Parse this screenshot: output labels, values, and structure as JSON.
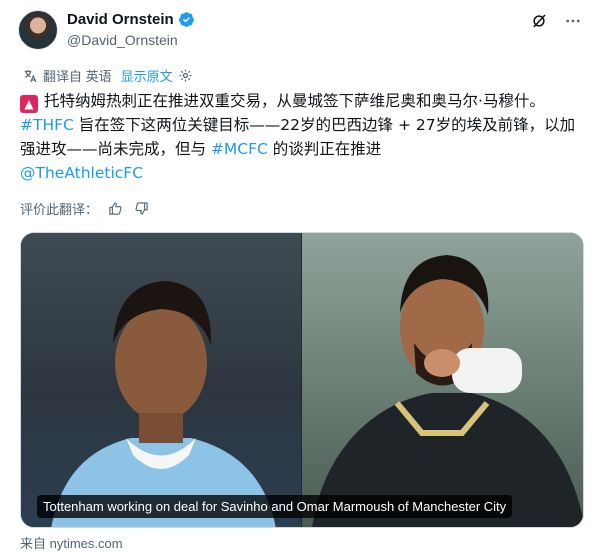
{
  "author": {
    "name": "David Ornstein",
    "handle": "@David_Ornstein",
    "verified_color": "#1d9bf0"
  },
  "translation_bar": {
    "label": "翻译自 英语",
    "show_original": "显示原文"
  },
  "tweet": {
    "line1_text": "托特纳姆热刺正在推进双重交易，从曼城签下萨维尼奥和奥马尔·马穆什。",
    "hashtag_thfc": "#THFC",
    "line2_text": " 旨在签下这两位关键目标——22岁的巴西边锋 + 27岁的埃及前锋，以加强进攻——尚未完成，但与 ",
    "hashtag_mcfc": "#MCFC",
    "line3_text": " 的谈判正在推进",
    "mention": "@TheAthleticFC"
  },
  "rating": {
    "label": "评价此翻译："
  },
  "media": {
    "caption": "Tottenham working on deal for Savinho and Omar Marmoush of Manchester City"
  },
  "source": {
    "label": "来自 nytimes.com"
  },
  "icons": {
    "verified": "verified-badge-icon",
    "grok": "grok-icon",
    "more": "more-icon",
    "translate": "translate-icon",
    "settings": "gear-icon",
    "thumbs_up": "thumbs-up-icon",
    "thumbs_down": "thumbs-down-icon",
    "siren": "siren-emoji-icon"
  }
}
